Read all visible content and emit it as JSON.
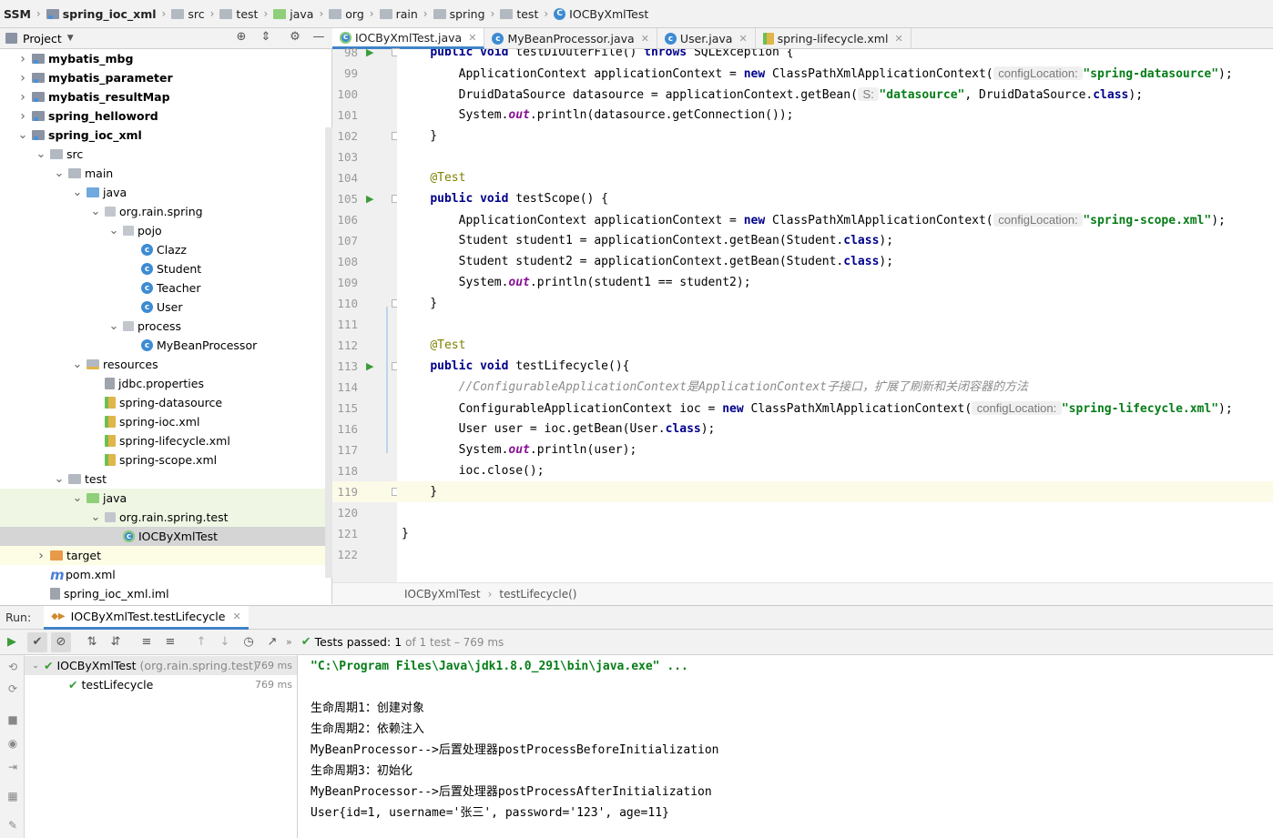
{
  "breadcrumb": [
    "SSM",
    "spring_ioc_xml",
    "src",
    "test",
    "java",
    "org",
    "rain",
    "spring",
    "test",
    "IOCByXmlTest"
  ],
  "project_panel": {
    "title": "Project"
  },
  "tree": [
    {
      "label": "mybatis_mbg",
      "depth": 0,
      "arrow": "right",
      "icon": "module",
      "bold": true
    },
    {
      "label": "mybatis_parameter",
      "depth": 0,
      "arrow": "right",
      "icon": "module",
      "bold": true
    },
    {
      "label": "mybatis_resultMap",
      "depth": 0,
      "arrow": "right",
      "icon": "module",
      "bold": true
    },
    {
      "label": "spring_helloword",
      "depth": 0,
      "arrow": "right",
      "icon": "module",
      "bold": true
    },
    {
      "label": "spring_ioc_xml",
      "depth": 0,
      "arrow": "down",
      "icon": "module",
      "bold": true
    },
    {
      "label": "src",
      "depth": 1,
      "arrow": "down",
      "icon": "folder"
    },
    {
      "label": "main",
      "depth": 2,
      "arrow": "down",
      "icon": "folder"
    },
    {
      "label": "java",
      "depth": 3,
      "arrow": "down",
      "icon": "folder-blue"
    },
    {
      "label": "org.rain.spring",
      "depth": 4,
      "arrow": "down",
      "icon": "package"
    },
    {
      "label": "pojo",
      "depth": 5,
      "arrow": "down",
      "icon": "package"
    },
    {
      "label": "Clazz",
      "depth": 6,
      "arrow": "",
      "icon": "class"
    },
    {
      "label": "Student",
      "depth": 6,
      "arrow": "",
      "icon": "class"
    },
    {
      "label": "Teacher",
      "depth": 6,
      "arrow": "",
      "icon": "class"
    },
    {
      "label": "User",
      "depth": 6,
      "arrow": "",
      "icon": "class"
    },
    {
      "label": "process",
      "depth": 5,
      "arrow": "down",
      "icon": "package"
    },
    {
      "label": "MyBeanProcessor",
      "depth": 6,
      "arrow": "",
      "icon": "class"
    },
    {
      "label": "resources",
      "depth": 3,
      "arrow": "down",
      "icon": "folder-res"
    },
    {
      "label": "jdbc.properties",
      "depth": 4,
      "arrow": "",
      "icon": "props"
    },
    {
      "label": "spring-datasource",
      "depth": 4,
      "arrow": "",
      "icon": "xml"
    },
    {
      "label": "spring-ioc.xml",
      "depth": 4,
      "arrow": "",
      "icon": "xml"
    },
    {
      "label": "spring-lifecycle.xml",
      "depth": 4,
      "arrow": "",
      "icon": "xml"
    },
    {
      "label": "spring-scope.xml",
      "depth": 4,
      "arrow": "",
      "icon": "xml"
    },
    {
      "label": "test",
      "depth": 2,
      "arrow": "down",
      "icon": "folder"
    },
    {
      "label": "java",
      "depth": 3,
      "arrow": "down",
      "icon": "folder-green",
      "hl": "green"
    },
    {
      "label": "org.rain.spring.test",
      "depth": 4,
      "arrow": "down",
      "icon": "package",
      "hl": "green"
    },
    {
      "label": "IOCByXmlTest",
      "depth": 5,
      "arrow": "",
      "icon": "class-test",
      "hl": "selected"
    },
    {
      "label": "target",
      "depth": 1,
      "arrow": "right",
      "icon": "folder-orange",
      "hl": "yellow"
    },
    {
      "label": "pom.xml",
      "depth": 1,
      "arrow": "",
      "icon": "maven"
    },
    {
      "label": "spring_ioc_xml.iml",
      "depth": 1,
      "arrow": "",
      "icon": "iml"
    }
  ],
  "tabs": [
    {
      "label": "IOCByXmlTest.java",
      "active": true,
      "icon": "class-test"
    },
    {
      "label": "MyBeanProcessor.java",
      "active": false,
      "icon": "class"
    },
    {
      "label": "User.java",
      "active": false,
      "icon": "class"
    },
    {
      "label": "spring-lifecycle.xml",
      "active": false,
      "icon": "xml"
    }
  ],
  "code_lines": [
    {
      "n": "98",
      "run": true,
      "fold": true,
      "tokens": [
        [
          "    ",
          ""
        ],
        [
          "public ",
          "kw"
        ],
        [
          "void ",
          "kw"
        ],
        [
          "testDIOuterFile() ",
          ""
        ],
        [
          "throws ",
          "kw"
        ],
        [
          "SQLException {",
          ""
        ]
      ]
    },
    {
      "n": "99",
      "tokens": [
        [
          "        ApplicationContext applicationContext = ",
          ""
        ],
        [
          "new ",
          "kw"
        ],
        [
          "ClassPathXmlApplicationContext(",
          ""
        ],
        [
          " configLocation: ",
          "hint"
        ],
        [
          "\"spring-datasource\"",
          "str"
        ],
        [
          ");",
          ""
        ]
      ]
    },
    {
      "n": "100",
      "tokens": [
        [
          "        DruidDataSource datasource = applicationContext.getBean(",
          ""
        ],
        [
          " S: ",
          "hint"
        ],
        [
          "\"datasource\"",
          "str"
        ],
        [
          ", DruidDataSource.",
          ""
        ],
        [
          "class",
          "kw"
        ],
        [
          ");",
          ""
        ]
      ]
    },
    {
      "n": "101",
      "tokens": [
        [
          "        System.",
          ""
        ],
        [
          "out",
          "st"
        ],
        [
          ".println(datasource.getConnection());",
          ""
        ]
      ]
    },
    {
      "n": "102",
      "fold": true,
      "tokens": [
        [
          "    }",
          ""
        ]
      ]
    },
    {
      "n": "103",
      "tokens": []
    },
    {
      "n": "104",
      "tokens": [
        [
          "    ",
          ""
        ],
        [
          "@Test",
          "ann"
        ]
      ]
    },
    {
      "n": "105",
      "run": true,
      "fold": true,
      "tokens": [
        [
          "    ",
          ""
        ],
        [
          "public ",
          "kw"
        ],
        [
          "void ",
          "kw"
        ],
        [
          "testScope() {",
          ""
        ]
      ]
    },
    {
      "n": "106",
      "tokens": [
        [
          "        ApplicationContext applicationContext = ",
          ""
        ],
        [
          "new ",
          "kw"
        ],
        [
          "ClassPathXmlApplicationContext(",
          ""
        ],
        [
          " configLocation: ",
          "hint"
        ],
        [
          "\"spring-scope.xml\"",
          "str"
        ],
        [
          ");",
          ""
        ]
      ]
    },
    {
      "n": "107",
      "tokens": [
        [
          "        Student student1 = applicationContext.getBean(Student.",
          ""
        ],
        [
          "class",
          "kw"
        ],
        [
          ");",
          ""
        ]
      ]
    },
    {
      "n": "108",
      "tokens": [
        [
          "        Student student2 = applicationContext.getBean(Student.",
          ""
        ],
        [
          "class",
          "kw"
        ],
        [
          ");",
          ""
        ]
      ]
    },
    {
      "n": "109",
      "tokens": [
        [
          "        System.",
          ""
        ],
        [
          "out",
          "st"
        ],
        [
          ".println(student1 == student2);",
          ""
        ]
      ]
    },
    {
      "n": "110",
      "fold": true,
      "tokens": [
        [
          "    }",
          ""
        ]
      ]
    },
    {
      "n": "111",
      "tokens": []
    },
    {
      "n": "112",
      "tokens": [
        [
          "    ",
          ""
        ],
        [
          "@Test",
          "ann"
        ]
      ]
    },
    {
      "n": "113",
      "run": true,
      "fold": true,
      "tokens": [
        [
          "    ",
          ""
        ],
        [
          "public ",
          "kw"
        ],
        [
          "void ",
          "kw"
        ],
        [
          "testLifecycle(){",
          ""
        ]
      ]
    },
    {
      "n": "114",
      "tokens": [
        [
          "        ",
          ""
        ],
        [
          "//ConfigurableApplicationContext是ApplicationContext子接口，扩展了刷新和关闭容器的方法",
          "cm"
        ]
      ]
    },
    {
      "n": "115",
      "tokens": [
        [
          "        ConfigurableApplicationContext ioc = ",
          ""
        ],
        [
          "new ",
          "kw"
        ],
        [
          "ClassPathXmlApplicationContext(",
          ""
        ],
        [
          " configLocation: ",
          "hint"
        ],
        [
          "\"spring-lifecycle.xml\"",
          "str"
        ],
        [
          ");",
          ""
        ]
      ]
    },
    {
      "n": "116",
      "tokens": [
        [
          "        User user = ioc.getBean(User.",
          ""
        ],
        [
          "class",
          "kw"
        ],
        [
          ");",
          ""
        ]
      ]
    },
    {
      "n": "117",
      "tokens": [
        [
          "        System.",
          ""
        ],
        [
          "out",
          "st"
        ],
        [
          ".println(user);",
          ""
        ]
      ]
    },
    {
      "n": "118",
      "tokens": [
        [
          "        ioc.close();",
          ""
        ]
      ]
    },
    {
      "n": "119",
      "current": true,
      "fold": true,
      "tokens": [
        [
          "    }",
          ""
        ]
      ]
    },
    {
      "n": "120",
      "tokens": []
    },
    {
      "n": "121",
      "tokens": [
        [
          "}",
          ""
        ]
      ]
    },
    {
      "n": "122",
      "tokens": []
    }
  ],
  "editor_breadcrumb": [
    "IOCByXmlTest",
    "testLifecycle()"
  ],
  "run": {
    "label": "Run:",
    "tab": "IOCByXmlTest.testLifecycle",
    "status_prefix": "Tests passed:",
    "status_count": "1",
    "status_suffix": "of 1 test – 769 ms",
    "test_tree": [
      {
        "name": "IOCByXmlTest",
        "pkg": "(org.rain.spring.test)",
        "time": "769 ms",
        "depth": 0
      },
      {
        "name": "testLifecycle",
        "pkg": "",
        "time": "769 ms",
        "depth": 1
      }
    ],
    "console": [
      "\"C:\\Program Files\\Java\\jdk1.8.0_291\\bin\\java.exe\" ...",
      "",
      "生命周期1：创建对象",
      "生命周期2：依赖注入",
      "MyBeanProcessor-->后置处理器postProcessBeforeInitialization",
      "生命周期3：初始化",
      "MyBeanProcessor-->后置处理器postProcessAfterInitialization",
      "User{id=1, username='张三', password='123', age=11}"
    ]
  }
}
